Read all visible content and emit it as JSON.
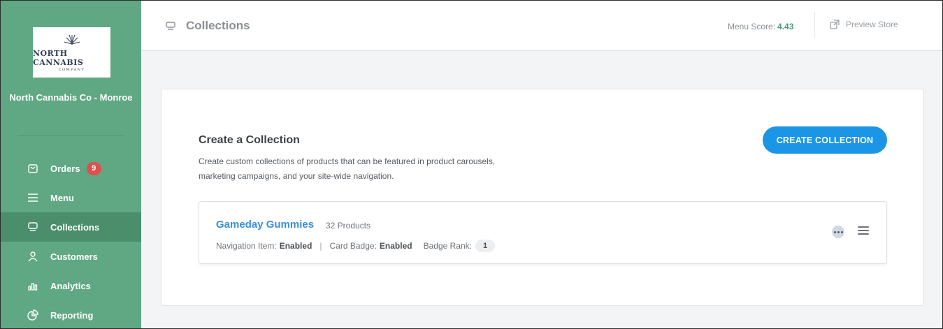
{
  "sidebar": {
    "logo": {
      "word": "NORTH CANNABIS",
      "sub": "COMPANY"
    },
    "store_name": "North Cannabis Co - Monroe",
    "items": [
      {
        "label": "Orders",
        "icon": "bag-icon",
        "badge": "9"
      },
      {
        "label": "Menu",
        "icon": "hamburger-icon"
      },
      {
        "label": "Collections",
        "icon": "monitor-icon",
        "active": true
      },
      {
        "label": "Customers",
        "icon": "user-icon"
      },
      {
        "label": "Analytics",
        "icon": "bar-chart-icon"
      },
      {
        "label": "Reporting",
        "icon": "pie-chart-icon"
      }
    ]
  },
  "header": {
    "title": "Collections",
    "menu_score_label": "Menu Score:",
    "menu_score_value": "4.43",
    "preview_label": "Preview Store"
  },
  "main": {
    "title": "Create a Collection",
    "description": "Create custom collections of products that can be featured in product carousels, marketing campaigns, and your site-wide navigation.",
    "create_button": "CREATE COLLECTION",
    "collections": [
      {
        "name": "Gameday Gummies",
        "count": "32 Products",
        "nav_label": "Navigation Item:",
        "nav_value": "Enabled",
        "badge_label": "Card Badge:",
        "badge_value": "Enabled",
        "rank_label": "Badge Rank:",
        "rank_value": "1"
      }
    ]
  },
  "colors": {
    "sidebar": "#5fa883",
    "sidebar_active": "#4a8e6b",
    "primary_button": "#1b95e6",
    "link": "#3a8fd6",
    "badge": "#e04f4f",
    "score": "#4f9b77"
  }
}
